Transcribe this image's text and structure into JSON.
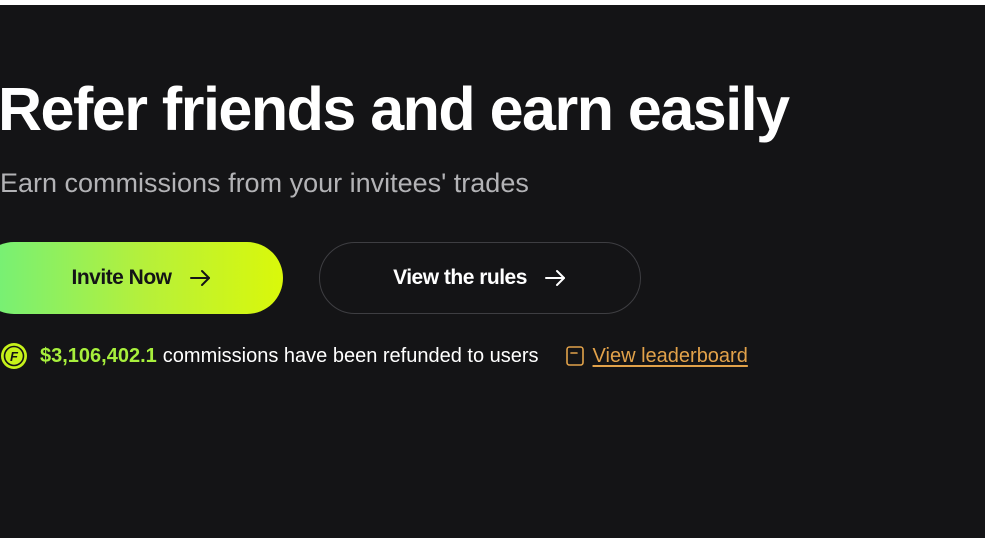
{
  "hero": {
    "title": "Refer friends and earn easily",
    "subtitle": "Earn commissions from your invitees' trades"
  },
  "actions": {
    "invite_label": "Invite Now",
    "invite_icon": "arrow-right-icon",
    "rules_label": "View the rules",
    "rules_icon": "arrow-right-icon"
  },
  "stats": {
    "coin_icon": "coin-icon",
    "coin_letter": "F",
    "amount": "$3,106,402.1",
    "text": "commissions have been refunded to users",
    "leaderboard_icon": "document-icon",
    "leaderboard_label": "View leaderboard"
  },
  "colors": {
    "background": "#141416",
    "accent_green": "#a7ef3c",
    "gradient_start": "#6ff07c",
    "gradient_end": "#daf80a",
    "link_orange": "#e2a24a",
    "subtitle_gray": "#b3b3b6"
  }
}
